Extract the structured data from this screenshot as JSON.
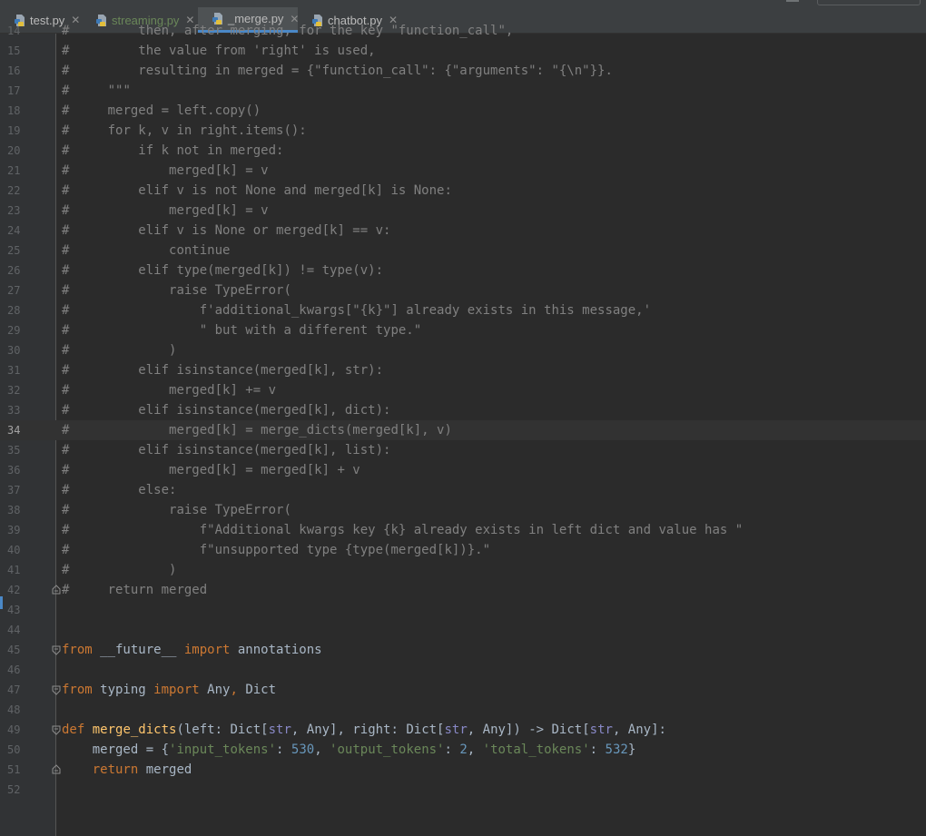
{
  "tabs": [
    {
      "label": "test.py",
      "icon": "python-file-icon",
      "active": false,
      "modified": false
    },
    {
      "label": "streaming.py",
      "icon": "python-file-icon",
      "active": false,
      "modified": true
    },
    {
      "label": "_merge.py",
      "icon": "python-file-icon",
      "active": true,
      "modified": false
    },
    {
      "label": "chatbot.py",
      "icon": "python-file-icon",
      "active": false,
      "modified": false
    }
  ],
  "close_glyph": "✕",
  "current_line": 34,
  "lines": [
    {
      "n": "14",
      "tokens": [
        {
          "t": "#",
          "c": "cmt"
        },
        {
          "t": "         then, after merging, for the key \"function_call\",",
          "c": "cmt"
        }
      ]
    },
    {
      "n": "15",
      "tokens": [
        {
          "t": "#",
          "c": "cmt"
        },
        {
          "t": "         the value from 'right' is used,",
          "c": "cmt"
        }
      ]
    },
    {
      "n": "16",
      "tokens": [
        {
          "t": "#",
          "c": "cmt"
        },
        {
          "t": "         resulting in merged = {\"function_call\": {\"arguments\": \"{\\n\"}}.",
          "c": "cmt"
        }
      ]
    },
    {
      "n": "17",
      "tokens": [
        {
          "t": "#",
          "c": "cmt"
        },
        {
          "t": "     \"\"\"",
          "c": "cmt"
        }
      ]
    },
    {
      "n": "18",
      "tokens": [
        {
          "t": "#",
          "c": "cmt"
        },
        {
          "t": "     merged = left.copy()",
          "c": "cmt"
        }
      ]
    },
    {
      "n": "19",
      "tokens": [
        {
          "t": "#",
          "c": "cmt"
        },
        {
          "t": "     for k, v in right.items():",
          "c": "cmt"
        }
      ]
    },
    {
      "n": "20",
      "tokens": [
        {
          "t": "#",
          "c": "cmt"
        },
        {
          "t": "         if k not in merged:",
          "c": "cmt"
        }
      ]
    },
    {
      "n": "21",
      "tokens": [
        {
          "t": "#",
          "c": "cmt"
        },
        {
          "t": "             merged[k] = v",
          "c": "cmt"
        }
      ]
    },
    {
      "n": "22",
      "tokens": [
        {
          "t": "#",
          "c": "cmt"
        },
        {
          "t": "         elif v is not None and merged[k] is None:",
          "c": "cmt"
        }
      ]
    },
    {
      "n": "23",
      "tokens": [
        {
          "t": "#",
          "c": "cmt"
        },
        {
          "t": "             merged[k] = v",
          "c": "cmt"
        }
      ]
    },
    {
      "n": "24",
      "tokens": [
        {
          "t": "#",
          "c": "cmt"
        },
        {
          "t": "         elif v is None or merged[k] == v:",
          "c": "cmt"
        }
      ]
    },
    {
      "n": "25",
      "tokens": [
        {
          "t": "#",
          "c": "cmt"
        },
        {
          "t": "             continue",
          "c": "cmt"
        }
      ]
    },
    {
      "n": "26",
      "tokens": [
        {
          "t": "#",
          "c": "cmt"
        },
        {
          "t": "         elif type(merged[k]) != type(v):",
          "c": "cmt"
        }
      ]
    },
    {
      "n": "27",
      "tokens": [
        {
          "t": "#",
          "c": "cmt"
        },
        {
          "t": "             raise TypeError(",
          "c": "cmt"
        }
      ]
    },
    {
      "n": "28",
      "tokens": [
        {
          "t": "#",
          "c": "cmt"
        },
        {
          "t": "                 f'additional_kwargs[\"{k}\"] already exists in this message,'",
          "c": "cmt"
        }
      ]
    },
    {
      "n": "29",
      "tokens": [
        {
          "t": "#",
          "c": "cmt"
        },
        {
          "t": "                 \" but with a different type.\"",
          "c": "cmt"
        }
      ]
    },
    {
      "n": "30",
      "tokens": [
        {
          "t": "#",
          "c": "cmt"
        },
        {
          "t": "             )",
          "c": "cmt"
        }
      ]
    },
    {
      "n": "31",
      "tokens": [
        {
          "t": "#",
          "c": "cmt"
        },
        {
          "t": "         elif isinstance(merged[k], str):",
          "c": "cmt"
        }
      ]
    },
    {
      "n": "32",
      "tokens": [
        {
          "t": "#",
          "c": "cmt"
        },
        {
          "t": "             merged[k] += v",
          "c": "cmt"
        }
      ]
    },
    {
      "n": "33",
      "tokens": [
        {
          "t": "#",
          "c": "cmt"
        },
        {
          "t": "         elif isinstance(merged[k], dict):",
          "c": "cmt"
        }
      ]
    },
    {
      "n": "34",
      "tokens": [
        {
          "t": "#",
          "c": "cmt"
        },
        {
          "t": "             merged[k] = merge_dicts(merged[k], v)",
          "c": "cmt"
        }
      ]
    },
    {
      "n": "35",
      "tokens": [
        {
          "t": "#",
          "c": "cmt"
        },
        {
          "t": "         elif isinstance(merged[k], list):",
          "c": "cmt"
        }
      ]
    },
    {
      "n": "36",
      "tokens": [
        {
          "t": "#",
          "c": "cmt"
        },
        {
          "t": "             merged[k] = merged[k] + v",
          "c": "cmt"
        }
      ]
    },
    {
      "n": "37",
      "tokens": [
        {
          "t": "#",
          "c": "cmt"
        },
        {
          "t": "         else:",
          "c": "cmt"
        }
      ]
    },
    {
      "n": "38",
      "tokens": [
        {
          "t": "#",
          "c": "cmt"
        },
        {
          "t": "             raise TypeError(",
          "c": "cmt"
        }
      ]
    },
    {
      "n": "39",
      "tokens": [
        {
          "t": "#",
          "c": "cmt"
        },
        {
          "t": "                 f\"Additional kwargs key {k} already exists in left dict and value has \"",
          "c": "cmt"
        }
      ]
    },
    {
      "n": "40",
      "tokens": [
        {
          "t": "#",
          "c": "cmt"
        },
        {
          "t": "                 f\"unsupported type {type(merged[k])}.\"",
          "c": "cmt"
        }
      ]
    },
    {
      "n": "41",
      "tokens": [
        {
          "t": "#",
          "c": "cmt"
        },
        {
          "t": "             )",
          "c": "cmt"
        }
      ]
    },
    {
      "n": "42",
      "fold": "end",
      "tokens": [
        {
          "t": "#",
          "c": "cmt"
        },
        {
          "t": "     return merged",
          "c": "cmt"
        }
      ]
    },
    {
      "n": "43",
      "tokens": []
    },
    {
      "n": "44",
      "tokens": []
    },
    {
      "n": "45",
      "fold": "start",
      "tokens": [
        {
          "t": "from",
          "c": "kw"
        },
        {
          "t": " __future__ ",
          "c": ""
        },
        {
          "t": "import",
          "c": "kw"
        },
        {
          "t": " annotations",
          "c": ""
        }
      ]
    },
    {
      "n": "46",
      "tokens": []
    },
    {
      "n": "47",
      "fold": "start",
      "tokens": [
        {
          "t": "from",
          "c": "kw"
        },
        {
          "t": " typing ",
          "c": ""
        },
        {
          "t": "import",
          "c": "kw"
        },
        {
          "t": " Any",
          "c": ""
        },
        {
          "t": ",",
          "c": "kw"
        },
        {
          "t": " Dict",
          "c": ""
        }
      ]
    },
    {
      "n": "48",
      "tokens": []
    },
    {
      "n": "49",
      "fold": "start",
      "tokens": [
        {
          "t": "def",
          "c": "kw"
        },
        {
          "t": " ",
          "c": ""
        },
        {
          "t": "merge_dicts",
          "c": "fn"
        },
        {
          "t": "(left: Dict[",
          "c": ""
        },
        {
          "t": "str",
          "c": "bi"
        },
        {
          "t": ", Any], right: Dict[",
          "c": ""
        },
        {
          "t": "str",
          "c": "bi"
        },
        {
          "t": ", Any]) -> Dict[",
          "c": ""
        },
        {
          "t": "str",
          "c": "bi"
        },
        {
          "t": ", Any]:",
          "c": ""
        }
      ]
    },
    {
      "n": "50",
      "tokens": [
        {
          "t": "    merged = {",
          "c": ""
        },
        {
          "t": "'input_tokens'",
          "c": "str"
        },
        {
          "t": ": ",
          "c": ""
        },
        {
          "t": "530",
          "c": "num"
        },
        {
          "t": ", ",
          "c": ""
        },
        {
          "t": "'output_tokens'",
          "c": "str"
        },
        {
          "t": ": ",
          "c": ""
        },
        {
          "t": "2",
          "c": "num"
        },
        {
          "t": ", ",
          "c": ""
        },
        {
          "t": "'total_tokens'",
          "c": "str"
        },
        {
          "t": ": ",
          "c": ""
        },
        {
          "t": "532",
          "c": "num"
        },
        {
          "t": "}",
          "c": ""
        }
      ]
    },
    {
      "n": "51",
      "fold": "end",
      "tokens": [
        {
          "t": "    ",
          "c": ""
        },
        {
          "t": "return",
          "c": "kw"
        },
        {
          "t": " merged",
          "c": ""
        }
      ]
    },
    {
      "n": "52",
      "tokens": []
    }
  ]
}
